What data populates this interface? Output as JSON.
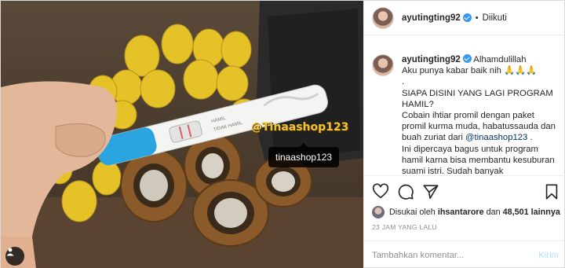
{
  "photo": {
    "tag": "tinaashop123",
    "watermark": "@Tinaashop123",
    "test_labels": [
      "HAMIL",
      "TIDAK HAMIL"
    ]
  },
  "header": {
    "username": "ayutingting92",
    "separator": "•",
    "follow_status": "Diikuti"
  },
  "caption": {
    "username": "ayutingting92",
    "first": "Alhamdulillah",
    "lines": [
      "Aku punya kabar baik nih 🙏🙏🙏",
      ".",
      "SIAPA DISINI YANG LAGI PROGRAM HAMIL?",
      "Cobain ihtiar promil dengan paket promil kurma muda, habatussauda dan buah zuriat dari"
    ],
    "mention": "@tinaashop123",
    "after_mention": " .",
    "tail": "Ini dipercaya bagus untuk program hamil karna bisa membantu kesuburan suami istri. Sudah banyak"
  },
  "likes": {
    "prefix": "Disukai oleh",
    "user": "ihsantarore",
    "middle": "dan",
    "count": "48,501 lainnya"
  },
  "timestamp": "23 JAM YANG LALU",
  "comment": {
    "placeholder": "Tambahkan komentar...",
    "post_label": "Kirim"
  },
  "colors": {
    "verified": "#3897f0",
    "link": "#003569",
    "post_disabled": "#b2dffc"
  }
}
